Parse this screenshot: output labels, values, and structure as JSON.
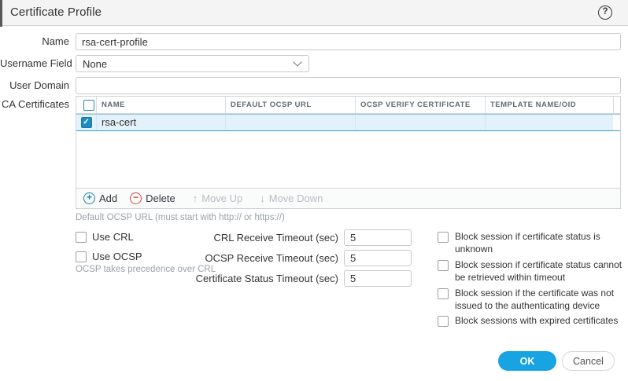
{
  "window": {
    "title": "Certificate Profile"
  },
  "icons": {
    "help": "?",
    "check": "✓",
    "add": "+",
    "delete": "−",
    "move_up": "↑",
    "move_down": "↓"
  },
  "colors": {
    "accent_blue": "#18a3e2",
    "selected_row_bg": "#e3f1fa",
    "selected_row_border": "#2fa3da",
    "checked_checkbox": "#1e8cbe",
    "add_icon_blue": "#1b7fae",
    "delete_icon_red": "#cf4b4b",
    "titlebar_bg": "#f4f4f4"
  },
  "form": {
    "name": {
      "label": "Name",
      "value": "rsa-cert-profile"
    },
    "username_field": {
      "label": "Username Field",
      "value": "None"
    },
    "user_domain": {
      "label": "User Domain",
      "value": ""
    },
    "ca_certificates": {
      "label": "CA Certificates",
      "columns": {
        "name": "NAME",
        "default_ocsp_url": "DEFAULT OCSP URL",
        "ocsp_verify_certificate": "OCSP VERIFY CERTIFICATE",
        "template_name_oid": "TEMPLATE NAME/OID"
      },
      "rows": [
        {
          "checked": true,
          "name": "rsa-cert",
          "default_ocsp_url": "",
          "ocsp_verify_certificate": "",
          "template_name_oid": ""
        }
      ],
      "toolbar": {
        "add": "Add",
        "delete": "Delete",
        "move_up": "Move Up",
        "move_down": "Move Down"
      }
    },
    "default_ocsp_url_note": "Default OCSP URL (must start with http:// or https://)",
    "use_crl": {
      "label": "Use CRL",
      "checked": false
    },
    "use_ocsp": {
      "label": "Use OCSP",
      "checked": false
    },
    "ocsp_precedence_note": "OCSP takes precedence over CRL",
    "timeouts": [
      {
        "label": "CRL Receive Timeout (sec)",
        "value": "5"
      },
      {
        "label": "OCSP Receive Timeout (sec)",
        "value": "5"
      },
      {
        "label": "Certificate Status Timeout (sec)",
        "value": "5"
      }
    ],
    "block_options": [
      {
        "label": "Block session if certificate status is unknown",
        "checked": false
      },
      {
        "label": "Block session if certificate status cannot be retrieved within timeout",
        "checked": false
      },
      {
        "label": "Block session if the certificate was not issued to the authenticating device",
        "checked": false
      },
      {
        "label": "Block sessions with expired certificates",
        "checked": false
      }
    ]
  },
  "footer": {
    "ok_label": "OK",
    "cancel_label": "Cancel"
  }
}
